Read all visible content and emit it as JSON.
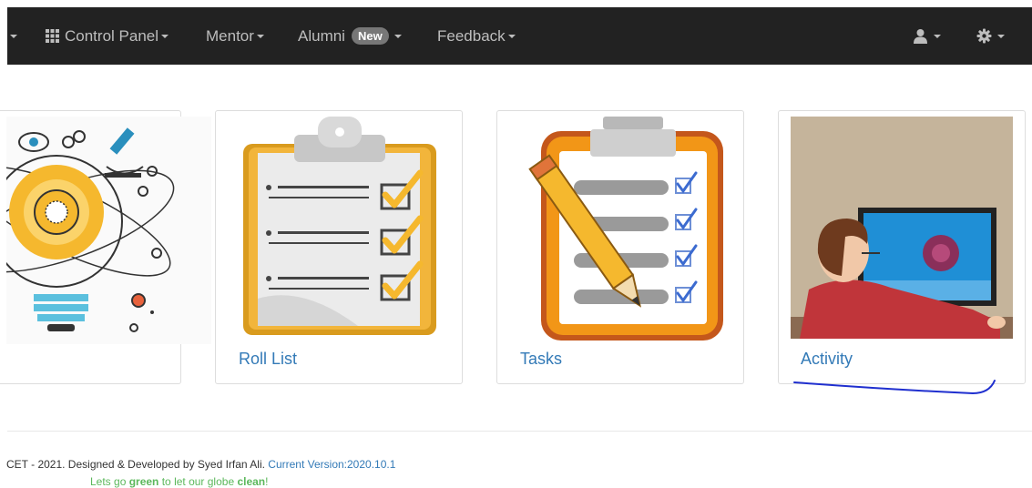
{
  "navbar": {
    "items": [
      {
        "label": "Control Panel"
      },
      {
        "label": "Mentor"
      },
      {
        "label": "Alumni",
        "badge": "New"
      },
      {
        "label": "Feedback"
      }
    ]
  },
  "cards": [
    {
      "label": ""
    },
    {
      "label": "Roll List"
    },
    {
      "label": "Tasks"
    },
    {
      "label": "Activity"
    }
  ],
  "footer": {
    "copyright": "CET - 2021. Designed & Developed by Syed Irfan Ali.",
    "version": "Current Version:2020.10.1",
    "green_pre": "Lets go ",
    "green_word1": "green",
    "green_mid": " to let our globe ",
    "green_word2": "clean",
    "green_end": "!"
  },
  "colors": {
    "navbar_bg": "#222222",
    "link": "#337ab7",
    "green": "#5cb85c",
    "badge": "#777777"
  }
}
